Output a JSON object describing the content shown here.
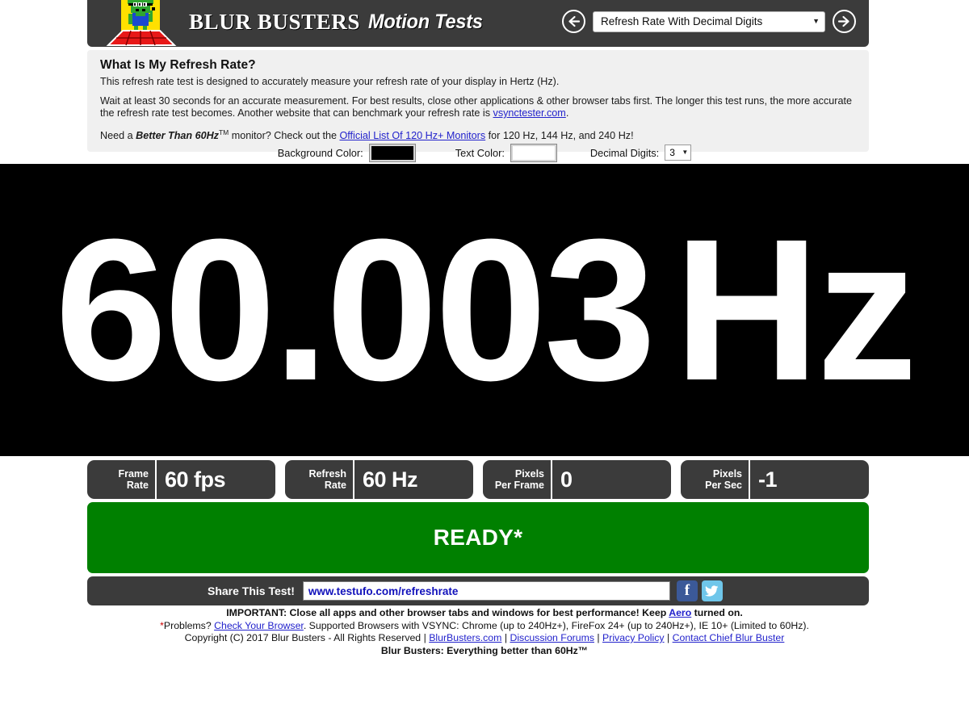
{
  "header": {
    "brand_main": "BLUR BUSTERS",
    "brand_sub": "Motion Tests",
    "logo_alt": "blur-busters-alien-logo",
    "prev_label": "←",
    "next_label": "→",
    "test_select": {
      "value": "Refresh Rate With Decimal Digits",
      "caret": "▼"
    },
    "bg_color": "#3b3b3b"
  },
  "info": {
    "title": "What Is My Refresh Rate?",
    "para1": "This refresh rate test is designed to accurately measure your refresh rate of your display in Hertz (Hz).",
    "para2_a": "Wait at least 30 seconds for an accurate measurement. For best results, close other applications & other browser tabs first. The longer this test runs, the more accurate the refresh rate test becomes. Another website that can benchmark your refresh rate is ",
    "para2_link": "vsynctester.com",
    "para2_b": ".",
    "para3_a": "Need a ",
    "para3_em": "Better Than 60Hz",
    "para3_tm": "TM",
    "para3_b": " monitor? Check out the ",
    "para3_link": "Official List Of 120 Hz+ Monitors",
    "para3_c": " for 120 Hz, 144 Hz, and 240 Hz!"
  },
  "controls": {
    "background_color_label": "Background Color:",
    "background_color_value": "#000000",
    "text_color_label": "Text Color:",
    "text_color_value": "#ffffff",
    "decimal_digits_label": "Decimal Digits:",
    "decimal_digits_value": "3",
    "decimal_digits_caret": "▼"
  },
  "display": {
    "value": "60.003",
    "unit": "Hz",
    "background": "#000000",
    "foreground": "#ffffff"
  },
  "stats": [
    {
      "label_line1": "Frame",
      "label_line2": "Rate",
      "value": "60 fps"
    },
    {
      "label_line1": "Refresh",
      "label_line2": "Rate",
      "value": "60 Hz"
    },
    {
      "label_line1": "Pixels",
      "label_line2": "Per Frame",
      "value": "0"
    },
    {
      "label_line1": "Pixels",
      "label_line2": "Per Sec",
      "value": "-1"
    }
  ],
  "banner": {
    "text": "READY*",
    "color": "#008000"
  },
  "share": {
    "label": "Share This Test!",
    "url": "www.testufo.com/refreshrate",
    "facebook_icon": "f",
    "twitter_icon": "t"
  },
  "footer": {
    "line1_a": "IMPORTANT: Close all apps and other browser tabs and windows for best performance! Keep ",
    "line1_link": "Aero",
    "line1_b": " turned on.",
    "line2_star": "*",
    "line2_a": "Problems? ",
    "line2_link": "Check Your Browser",
    "line2_b": ". Supported Browsers with VSYNC: Chrome (up to 240Hz+), FireFox 24+ (up to 240Hz+), IE 10+ (Limited to 60Hz).",
    "line3_a": "Copyright (C) 2017 Blur Busters - All Rights Reserved | ",
    "line3_link1": "BlurBusters.com",
    "line3_sep1": " | ",
    "line3_link2": "Discussion Forums",
    "line3_sep2": " | ",
    "line3_link3": "Privacy Policy",
    "line3_sep3": " | ",
    "line3_link4": "Contact Chief Blur Buster",
    "line4": "Blur Busters: Everything better than 60Hz™"
  }
}
